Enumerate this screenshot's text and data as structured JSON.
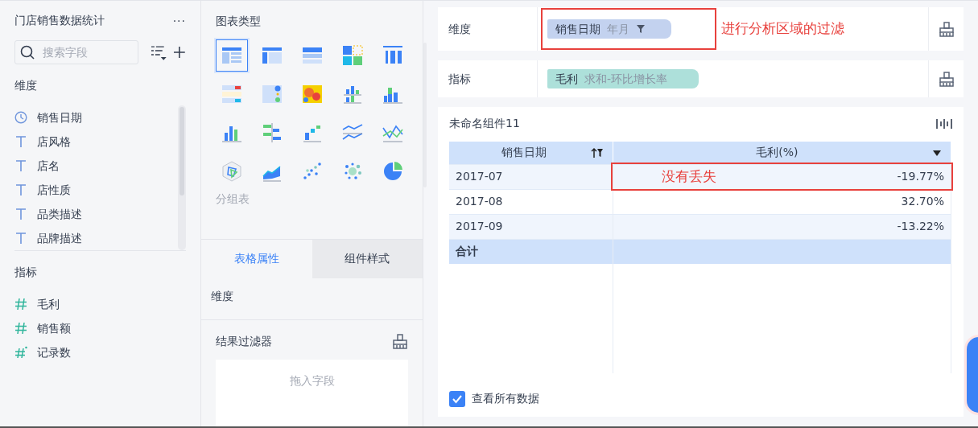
{
  "sidebar": {
    "title": "门店销售数据统计",
    "menu": "···",
    "search": {
      "placeholder": "搜索字段"
    },
    "dimensions": {
      "title": "维度",
      "items": [
        {
          "label": "销售日期",
          "kind": "date"
        },
        {
          "label": "店风格",
          "kind": "text"
        },
        {
          "label": "店名",
          "kind": "text"
        },
        {
          "label": "店性质",
          "kind": "text"
        },
        {
          "label": "品类描述",
          "kind": "text"
        },
        {
          "label": "品牌描述",
          "kind": "text"
        }
      ]
    },
    "measures": {
      "title": "指标",
      "items": [
        {
          "label": "毛利",
          "kind": "number"
        },
        {
          "label": "销售额",
          "kind": "number"
        },
        {
          "label": "记录数",
          "kind": "count"
        }
      ]
    }
  },
  "chart_panel": {
    "title": "图表类型",
    "types": [
      {
        "kind": "grouped-table",
        "selected": true
      },
      {
        "kind": "cross-table",
        "selected": false
      },
      {
        "kind": "detail-table",
        "selected": false
      },
      {
        "kind": "color-table",
        "selected": false
      },
      {
        "kind": "kpi-number",
        "selected": false
      },
      {
        "kind": "kpi-list",
        "selected": false
      },
      {
        "kind": "kpi-dots",
        "selected": false
      },
      {
        "kind": "heatmap",
        "selected": false
      },
      {
        "kind": "stacked-column",
        "selected": false
      },
      {
        "kind": "grouped-column",
        "selected": false
      },
      {
        "kind": "column",
        "selected": false
      },
      {
        "kind": "range-bar",
        "selected": false
      },
      {
        "kind": "waterfall",
        "selected": false
      },
      {
        "kind": "line",
        "selected": false
      },
      {
        "kind": "cross-line",
        "selected": false
      },
      {
        "kind": "radar",
        "selected": false
      },
      {
        "kind": "area",
        "selected": false
      },
      {
        "kind": "scatter",
        "selected": false
      },
      {
        "kind": "bubble",
        "selected": false
      },
      {
        "kind": "pie",
        "selected": false
      }
    ],
    "type_label": "分组表",
    "tabs": [
      {
        "label": "表格属性",
        "selected": true
      },
      {
        "label": "组件样式",
        "selected": false
      }
    ],
    "property_section": "维度",
    "result_filter": {
      "title": "结果过滤器",
      "placeholder": "拖入字段"
    }
  },
  "analysis": {
    "dimension": {
      "label": "维度",
      "highlighted": true,
      "pill": {
        "name": "销售日期",
        "detail": "年月",
        "filtered": true
      },
      "annotation": "进行分析区域的过滤"
    },
    "measure": {
      "label": "指标",
      "highlighted": false,
      "pill": {
        "name": "毛利",
        "detail": "求和-环比增长率",
        "filtered": false
      }
    }
  },
  "component": {
    "title": "未命名组件11",
    "table": {
      "columns": [
        {
          "label": "销售日期",
          "sort_filter": true
        },
        {
          "label": "毛利(%)",
          "sort_filter": false
        }
      ],
      "rows": [
        {
          "date": "2017-07",
          "value": "-19.77%",
          "highlighted": true,
          "note": "没有丢失"
        },
        {
          "date": "2017-08",
          "value": "32.70%",
          "highlighted": false
        },
        {
          "date": "2017-09",
          "value": "-13.22%",
          "highlighted": false
        }
      ],
      "total": {
        "label": "合计"
      }
    },
    "show_all": {
      "label": "查看所有数据",
      "checked": true
    }
  }
}
